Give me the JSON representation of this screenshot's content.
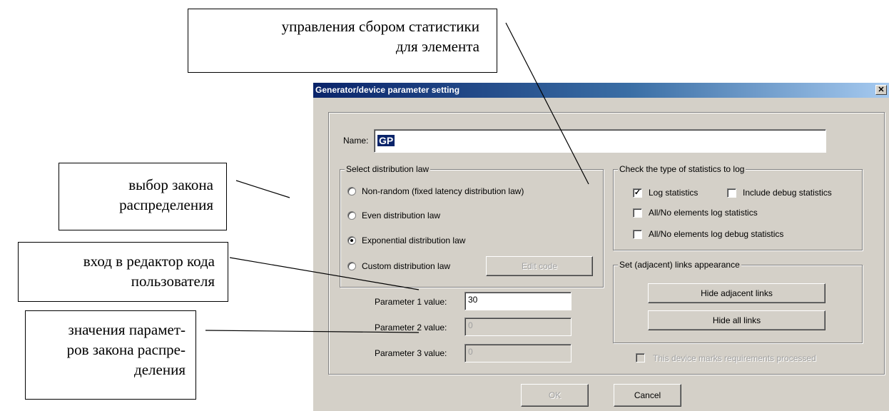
{
  "annotations": {
    "stats": [
      "управления сбором статистики",
      "для элемента"
    ],
    "law": [
      "выбор закона",
      "распределения"
    ],
    "editor": [
      "вход в редактор кода",
      "пользователя"
    ],
    "params": [
      "значения парамет-",
      "ров закона распре-",
      "деления"
    ]
  },
  "dialog": {
    "title": "Generator/device parameter setting",
    "close_glyph": "✕",
    "name_label": "Name:",
    "name_value": "GP",
    "distribution": {
      "title": "Select distribution law",
      "options": [
        {
          "label": "Non-random (fixed latency distribution law)",
          "selected": false
        },
        {
          "label": "Even distribution law",
          "selected": false
        },
        {
          "label": "Exponential distribution law",
          "selected": true
        },
        {
          "label": "Custom distribution law",
          "selected": false
        }
      ],
      "edit_code": "Edit code"
    },
    "params": [
      {
        "label": "Parameter 1 value:",
        "value": "30",
        "enabled": true
      },
      {
        "label": "Parameter 2 value:",
        "value": "0",
        "enabled": false
      },
      {
        "label": "Parameter 3 value:",
        "value": "0",
        "enabled": false
      }
    ],
    "stats": {
      "title": "Check the type of statistics to log",
      "log_statistics": "Log statistics",
      "log_statistics_checked": true,
      "include_debug": "Include debug statistics",
      "include_debug_checked": false,
      "all_log": "All/No elements log statistics",
      "all_log_checked": false,
      "all_debug": "All/No elements log debug statistics",
      "all_debug_checked": false
    },
    "links": {
      "title": "Set (adjacent) links appearance",
      "hide_adjacent": "Hide adjacent links",
      "hide_all": "Hide all links"
    },
    "marks_processed": "This device marks requirements processed",
    "ok": "OK",
    "cancel": "Cancel",
    "check_glyph": "✓"
  }
}
